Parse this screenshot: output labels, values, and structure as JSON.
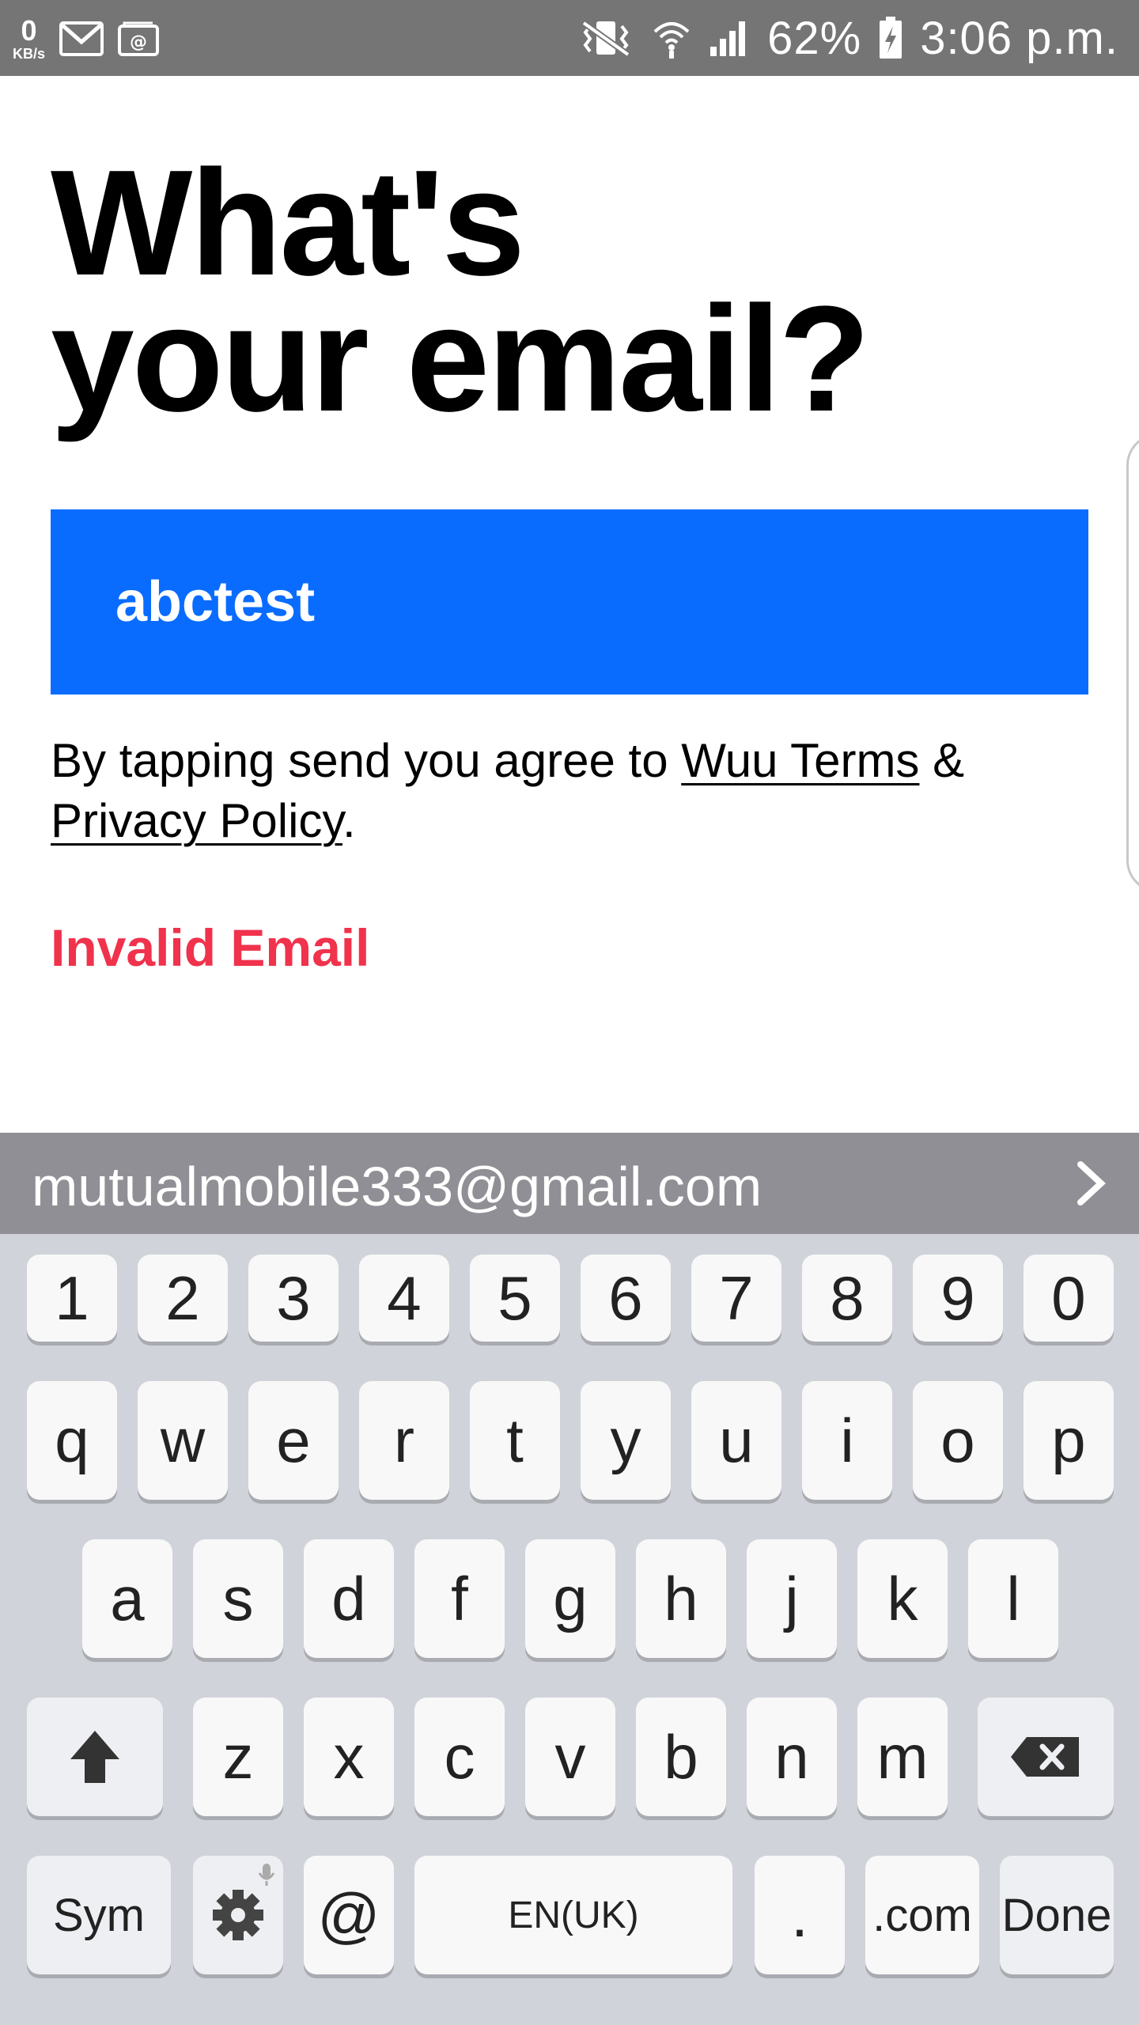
{
  "status_bar": {
    "net_speed_value": "0",
    "net_speed_unit": "KB/s",
    "battery_percent": "62%",
    "time": "3:06 p.m.",
    "left_icons": [
      "gmail-icon",
      "email-icon"
    ],
    "right_icons": [
      "vibrate-icon",
      "wifi-icon",
      "signal-icon",
      "battery-charging-icon"
    ]
  },
  "page": {
    "title_line1": "What's",
    "title_line2": "your email?",
    "email_value": "abctest",
    "terms_prefix": "By tapping send you agree to ",
    "terms_link": "Wuu Terms",
    "terms_amp": " &",
    "privacy_link": "Privacy Policy",
    "terms_end": ".",
    "error_text": "Invalid Email",
    "colors": {
      "input_bg": "#0a6cff",
      "error": "#f0324c"
    }
  },
  "keyboard": {
    "suggestion": "mutualmobile333@gmail.com",
    "row_numbers": [
      "1",
      "2",
      "3",
      "4",
      "5",
      "6",
      "7",
      "8",
      "9",
      "0"
    ],
    "row_q": [
      "q",
      "w",
      "e",
      "r",
      "t",
      "y",
      "u",
      "i",
      "o",
      "p"
    ],
    "row_a": [
      "a",
      "s",
      "d",
      "f",
      "g",
      "h",
      "j",
      "k",
      "l"
    ],
    "row_z": [
      "z",
      "x",
      "c",
      "v",
      "b",
      "n",
      "m"
    ],
    "sym": "Sym",
    "at": "@",
    "space": "EN(UK)",
    "period": ".",
    "dotcom": ".com",
    "done": "Done"
  }
}
